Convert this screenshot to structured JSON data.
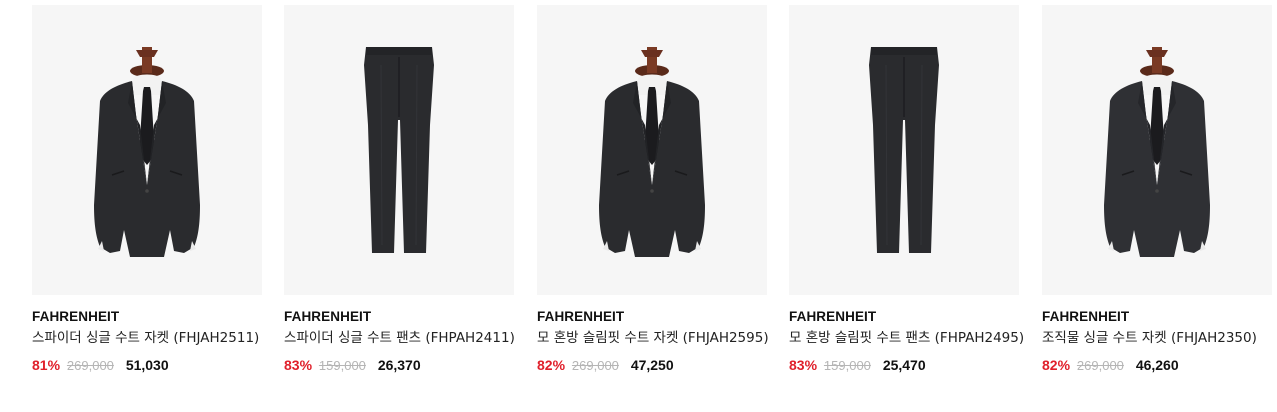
{
  "products": [
    {
      "brand": "FAHRENHEIT",
      "name": "스파이더 싱글 수트 자켓 (FHJAH2511)",
      "discount": "81%",
      "original_price": "269,000",
      "sale_price": "51,030",
      "image": "suit-jacket"
    },
    {
      "brand": "FAHRENHEIT",
      "name": "스파이더 싱글 수트 팬츠 (FHPAH2411)",
      "discount": "83%",
      "original_price": "159,000",
      "sale_price": "26,370",
      "image": "suit-pants"
    },
    {
      "brand": "FAHRENHEIT",
      "name": "모 혼방 슬림핏 수트 자켓 (FHJAH2595)",
      "discount": "82%",
      "original_price": "269,000",
      "sale_price": "47,250",
      "image": "suit-jacket"
    },
    {
      "brand": "FAHRENHEIT",
      "name": "모 혼방 슬림핏 수트 팬츠 (FHPAH2495)",
      "discount": "83%",
      "original_price": "159,000",
      "sale_price": "25,470",
      "image": "suit-pants"
    },
    {
      "brand": "FAHRENHEIT",
      "name": "조직물 싱글 수트 자켓 (FHJAH2350)",
      "discount": "82%",
      "original_price": "269,000",
      "sale_price": "46,260",
      "image": "suit-jacket"
    }
  ],
  "colors": {
    "discount": "#e0202b",
    "original_price": "#b5b5b5",
    "image_bg": "#f6f6f6",
    "fabric": "#2a2b2e"
  }
}
